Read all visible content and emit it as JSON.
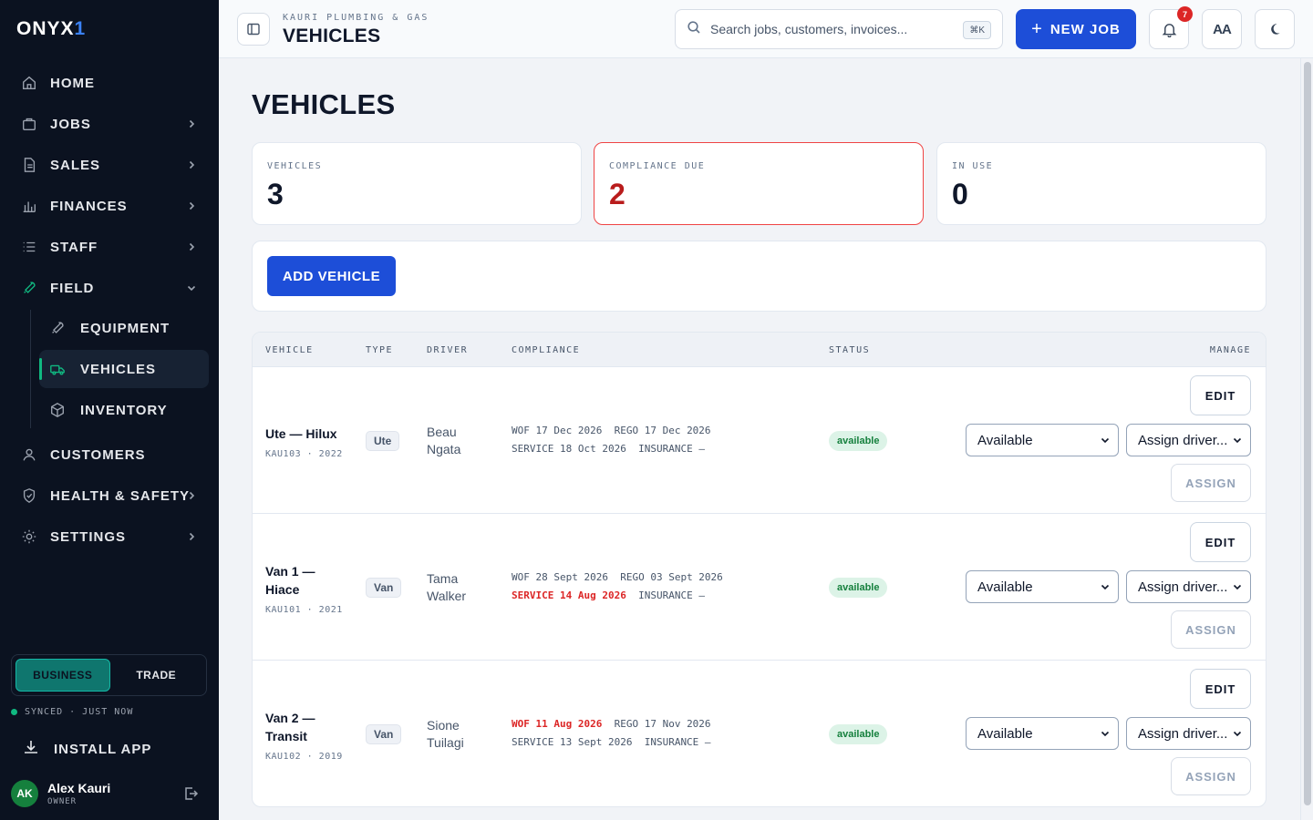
{
  "brand": {
    "logo_text": "ONYX",
    "logo_accent": "1",
    "accent_color": "#3b82f6"
  },
  "sidebar": {
    "nav": [
      {
        "label": "HOME",
        "icon": "home-icon",
        "expandable": false
      },
      {
        "label": "JOBS",
        "icon": "briefcase-icon",
        "expandable": true
      },
      {
        "label": "SALES",
        "icon": "document-icon",
        "expandable": true
      },
      {
        "label": "FINANCES",
        "icon": "bar-chart-icon",
        "expandable": true
      },
      {
        "label": "STAFF",
        "icon": "list-icon",
        "expandable": true
      },
      {
        "label": "FIELD",
        "icon": "wrench-icon",
        "expandable": true,
        "expanded": true
      },
      {
        "label": "CUSTOMERS",
        "icon": "user-icon",
        "expandable": false
      },
      {
        "label": "HEALTH & SAFETY",
        "icon": "shield-icon",
        "expandable": true
      },
      {
        "label": "SETTINGS",
        "icon": "gear-icon",
        "expandable": true
      }
    ],
    "field_sub": [
      {
        "label": "EQUIPMENT",
        "icon": "wrench-icon",
        "active": false
      },
      {
        "label": "VEHICLES",
        "icon": "truck-icon",
        "active": true
      },
      {
        "label": "INVENTORY",
        "icon": "box-icon",
        "active": false
      }
    ],
    "mode": {
      "options": [
        "BUSINESS",
        "TRADE"
      ],
      "selected": "BUSINESS"
    },
    "sync_status": "SYNCED · JUST NOW",
    "install_label": "INSTALL APP",
    "user": {
      "initials": "AK",
      "name": "Alex Kauri",
      "role": "OWNER"
    }
  },
  "topbar": {
    "org_name": "KAURI PLUMBING & GAS",
    "title": "VEHICLES",
    "search_placeholder": "Search jobs, customers, invoices...",
    "search_shortcut": "⌘K",
    "new_job_label": "NEW JOB",
    "notification_count": "7",
    "text_size_label": "AA"
  },
  "page": {
    "heading": "VEHICLES",
    "stats": [
      {
        "label": "VEHICLES",
        "value": "3",
        "highlight": false
      },
      {
        "label": "COMPLIANCE DUE",
        "value": "2",
        "highlight": true
      },
      {
        "label": "IN USE",
        "value": "0",
        "highlight": false
      }
    ],
    "add_vehicle_label": "ADD VEHICLE",
    "table": {
      "headers": [
        "VEHICLE",
        "TYPE",
        "DRIVER",
        "COMPLIANCE",
        "STATUS",
        "MANAGE"
      ],
      "rows": [
        {
          "name_lines": [
            "Ute — Hilux"
          ],
          "plate_year": "KAU103 · 2022",
          "type": "Ute",
          "driver_lines": [
            "Beau",
            "Ngata"
          ],
          "compliance": [
            [
              {
                "text": "WOF 17 Dec 2026",
                "due": false
              },
              {
                "text": "REGO 17 Dec 2026",
                "due": false
              }
            ],
            [
              {
                "text": "SERVICE 18 Oct 2026",
                "due": false
              },
              {
                "text": "INSURANCE —",
                "due": false
              }
            ]
          ],
          "status": "available",
          "status_select": "Available",
          "driver_select": "Assign driver...",
          "edit_label": "EDIT",
          "assign_label": "ASSIGN"
        },
        {
          "name_lines": [
            "Van 1 —",
            "Hiace"
          ],
          "plate_year": "KAU101 · 2021",
          "type": "Van",
          "driver_lines": [
            "Tama",
            "Walker"
          ],
          "compliance": [
            [
              {
                "text": "WOF 28 Sept 2026",
                "due": false
              },
              {
                "text": "REGO 03 Sept 2026",
                "due": false
              }
            ],
            [
              {
                "text": "SERVICE 14 Aug 2026",
                "due": true
              },
              {
                "text": "INSURANCE —",
                "due": false
              }
            ]
          ],
          "status": "available",
          "status_select": "Available",
          "driver_select": "Assign driver...",
          "edit_label": "EDIT",
          "assign_label": "ASSIGN"
        },
        {
          "name_lines": [
            "Van 2 —",
            "Transit"
          ],
          "plate_year": "KAU102 · 2019",
          "type": "Van",
          "driver_lines": [
            "Sione",
            "Tuilagi"
          ],
          "compliance": [
            [
              {
                "text": "WOF 11 Aug 2026",
                "due": true
              },
              {
                "text": "REGO 17 Nov 2026",
                "due": false
              }
            ],
            [
              {
                "text": "SERVICE 13 Sept 2026",
                "due": false
              },
              {
                "text": "INSURANCE —",
                "due": false
              }
            ]
          ],
          "status": "available",
          "status_select": "Available",
          "driver_select": "Assign driver...",
          "edit_label": "EDIT",
          "assign_label": "ASSIGN"
        }
      ]
    }
  }
}
